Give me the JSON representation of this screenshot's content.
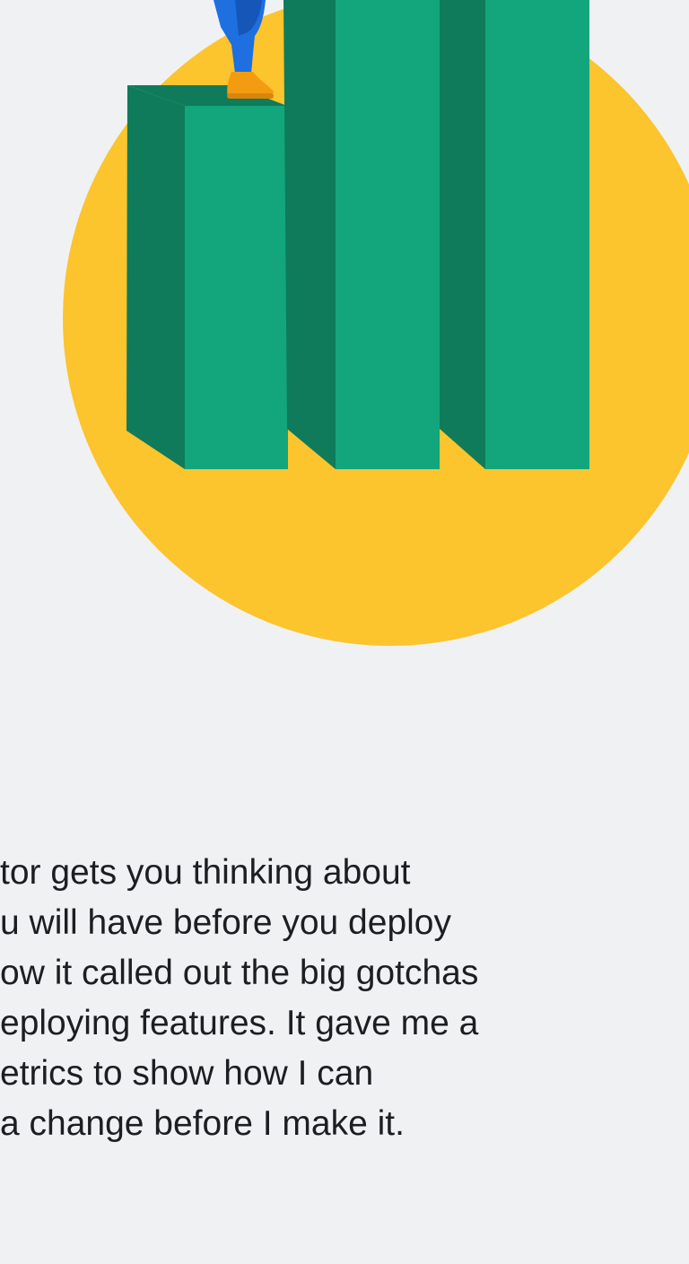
{
  "colors": {
    "background": "#f0f1f3",
    "circle": "#fcc42d",
    "bar_front": "#13a57c",
    "bar_side": "#0f7b5a",
    "person_pants": "#1e6fe0",
    "person_shoe": "#f39c12",
    "text": "#1c1e21"
  },
  "illustration": {
    "name": "person-on-bar-chart-illustration"
  },
  "testimonial": {
    "lines": [
      "tor gets you thinking about",
      "u will have before you deploy",
      "ow it called out the big gotchas",
      "eploying features. It gave me a",
      "etrics to show how I can",
      "a change before I make it."
    ]
  }
}
